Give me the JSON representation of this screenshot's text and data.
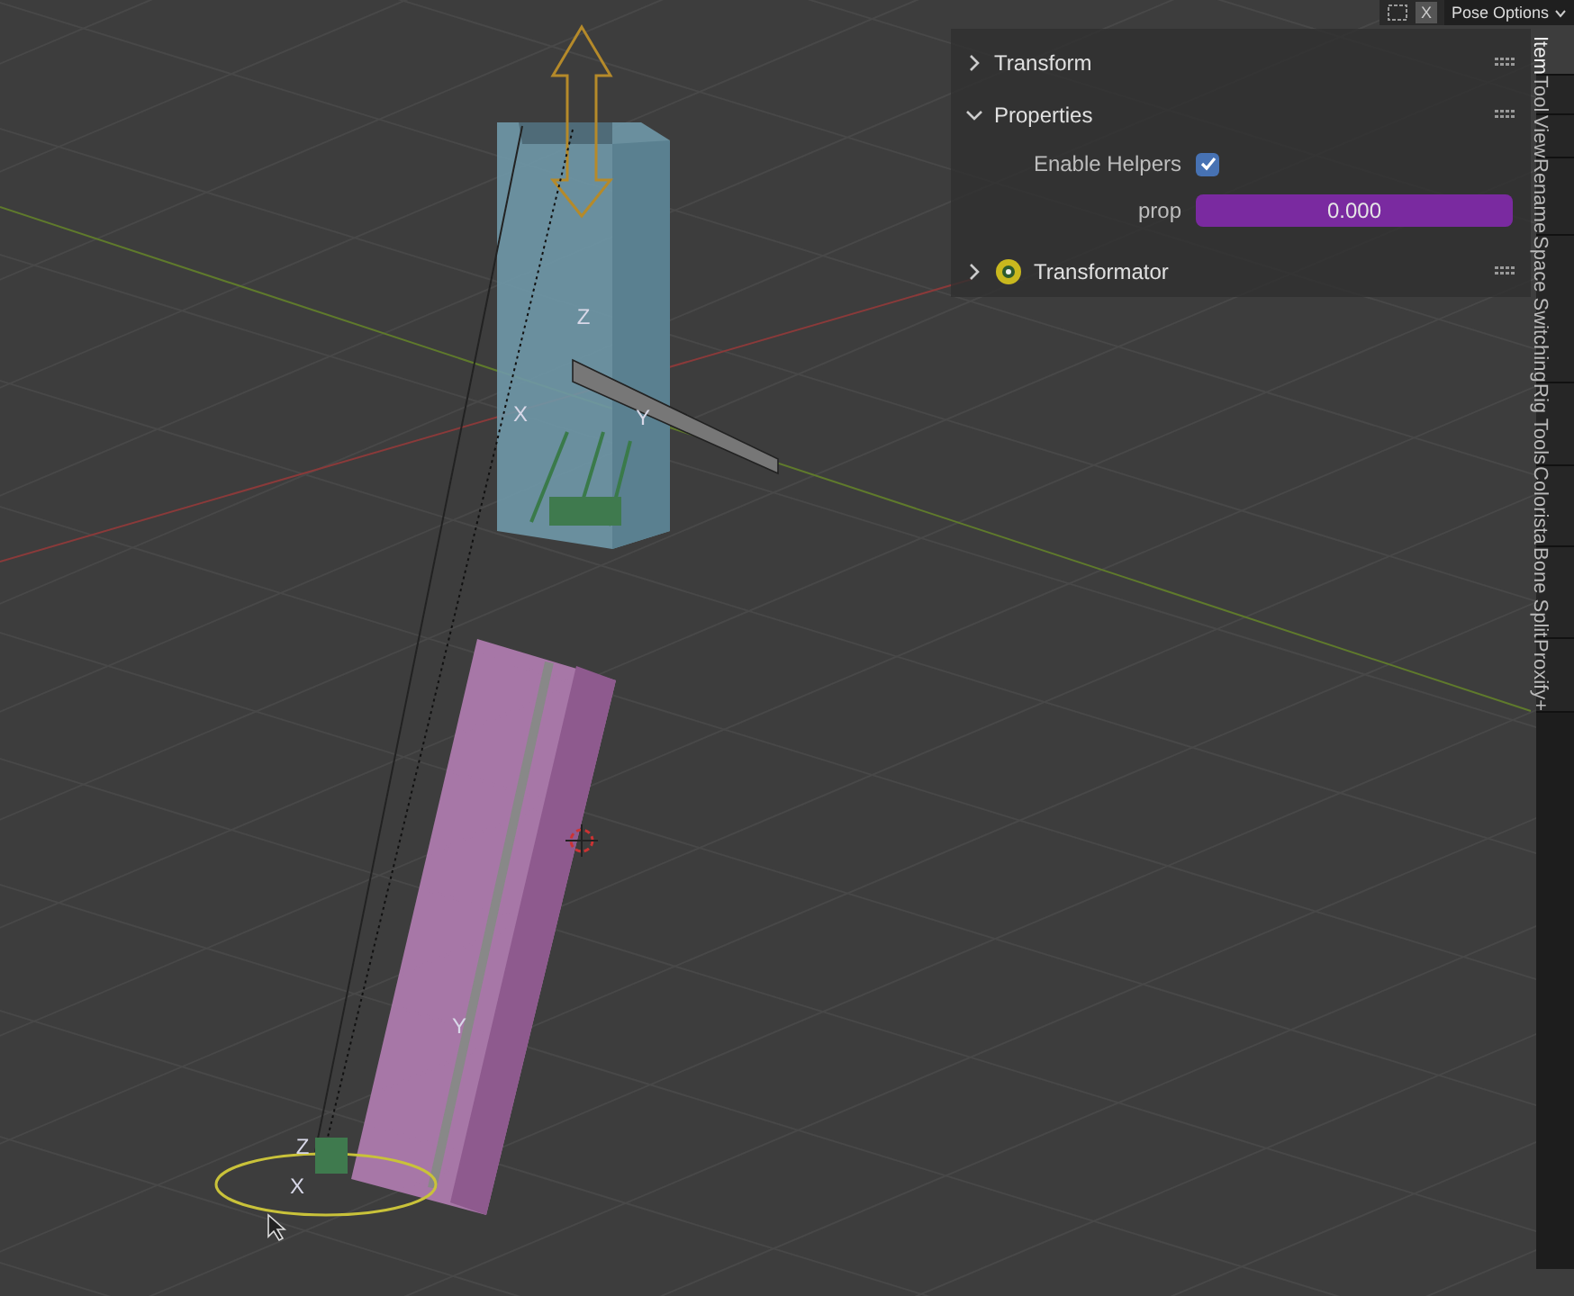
{
  "header": {
    "close_label": "X",
    "menu_label": "Pose Options"
  },
  "panels": [
    {
      "title": "Transform",
      "expanded": false,
      "kind": "plain"
    },
    {
      "title": "Properties",
      "expanded": true,
      "kind": "plain",
      "fields": [
        {
          "kind": "checkbox",
          "label": "Enable Helpers",
          "checked": true
        },
        {
          "kind": "number",
          "label": "prop",
          "value": "0.000"
        }
      ]
    },
    {
      "title": "Transformator",
      "expanded": false,
      "kind": "addon"
    }
  ],
  "tabs": [
    {
      "label": "Item",
      "selected": true
    },
    {
      "label": "Tool",
      "selected": false
    },
    {
      "label": "View",
      "selected": false
    },
    {
      "label": "Rename",
      "selected": false
    },
    {
      "label": "Space Switching",
      "selected": false
    },
    {
      "label": "Rig Tools",
      "selected": false
    },
    {
      "label": "Colorista",
      "selected": false
    },
    {
      "label": "Bone Split",
      "selected": false
    },
    {
      "label": "Proxify+",
      "selected": false
    }
  ],
  "viewport": {
    "axis_labels": [
      {
        "text": "Z"
      },
      {
        "text": "X"
      },
      {
        "text": "Y"
      },
      {
        "text": "Y"
      },
      {
        "text": "Z"
      },
      {
        "text": "X"
      }
    ]
  }
}
